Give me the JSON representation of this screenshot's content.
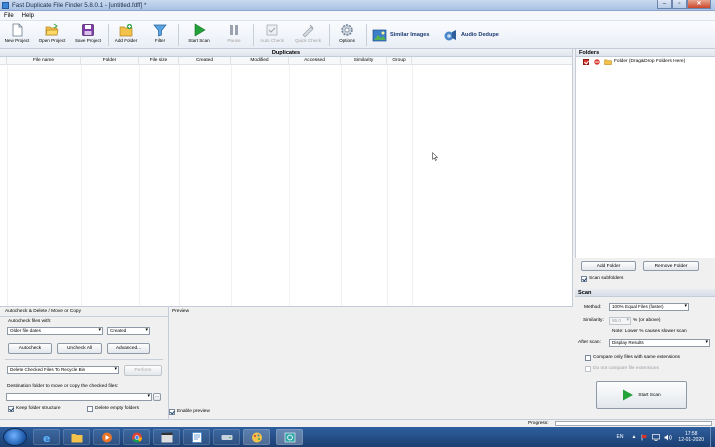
{
  "window": {
    "title": "Fast Duplicate File Finder 5.8.0.1 - [untitled.fdff] *"
  },
  "menu": [
    "File",
    "Help"
  ],
  "toolbar": {
    "new_project": "New Project",
    "open_project": "Open Project",
    "save_project": "Save Project",
    "add_folder": "Add Folder",
    "filter": "Filter",
    "start_scan": "Start Scan",
    "pause": "Pause",
    "auto_check": "Auto Check",
    "quick_check": "Quick Check",
    "options": "Options",
    "similar_images": "Similar Images",
    "audio_dedupe": "Audio Dedupe"
  },
  "duplicates": {
    "title": "Duplicates",
    "columns": [
      "File name",
      "Folder",
      "File size",
      "Created",
      "Modified",
      "Accessed",
      "Similarity",
      "Group"
    ]
  },
  "folders": {
    "title": "Folders",
    "row_label": "Folder (Drag&Drop Folders Here)",
    "add_button": "Add Folder",
    "remove_button": "Remove Folder",
    "scan_subfolders": "Scan subfolders"
  },
  "scan": {
    "title": "Scan",
    "method_label": "Method:",
    "method_value": "100% Equal Files (faster)",
    "similarity_label": "Similarity:",
    "similarity_value": "95.0",
    "similarity_suffix": "% (or above)",
    "note": "Note: Lower % causes slower scan",
    "after_scan_label": "After scan:",
    "after_scan_value": "Display Results",
    "compare_same_ext": "Compare only files with same extensions",
    "not_compare_ext": "Do not compare file extensions",
    "start_button": "Start Scan"
  },
  "autocheck": {
    "title": "Autocheck & Delete / Move or Copy",
    "autocheck_with_label": "Autocheck files with:",
    "older_value": "Older file dates",
    "created_value": "Created",
    "autocheck_button": "Autocheck",
    "uncheck_all_button": "Uncheck All",
    "advanced_button": "Advanced...",
    "action_value": "Delete Checked Files To Recycle Bin",
    "perform_button": "Perform",
    "destination_label": "Destination folder to move or copy the checked files:",
    "destination_value": "",
    "browse_button": "...",
    "keep_structure": "Keep folder structure",
    "delete_empty": "Delete empty folders"
  },
  "preview": {
    "title": "Preview",
    "enable": "Enable preview"
  },
  "status": {
    "progress_label": "Progress:",
    "progress_value": 0
  },
  "taskbar": {
    "language": "EN",
    "time": "17:58",
    "date": "12-01-2020"
  }
}
